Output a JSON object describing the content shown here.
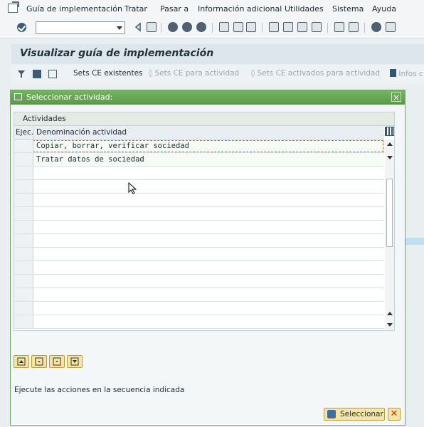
{
  "menu": {
    "items": [
      "Guía de implementación",
      "Tratar",
      "Pasar a",
      "Información adicional",
      "Utilidades",
      "Sistema",
      "Ayuda"
    ]
  },
  "page": {
    "title": "Visualizar guía de implementación"
  },
  "app_toolbar": {
    "sets_ce_existentes": "Sets CE existentes",
    "sets_ce_para_actividad": "Sets CE para actividad",
    "sets_ce_activados": "Sets CE activados para actividad",
    "infos": "Infos c"
  },
  "dialog": {
    "title": "Seleccionar actividad:",
    "table_caption": "Actividades",
    "col_ejec": "Ejec.",
    "col_denominacion": "Denominación actividad",
    "rows": [
      "Copiar, borrar, verificar sociedad",
      "Tratar datos de sociedad"
    ],
    "info_text": "Ejecute las acciones en la secuencia indicada",
    "select_label": "Seleccionar"
  }
}
